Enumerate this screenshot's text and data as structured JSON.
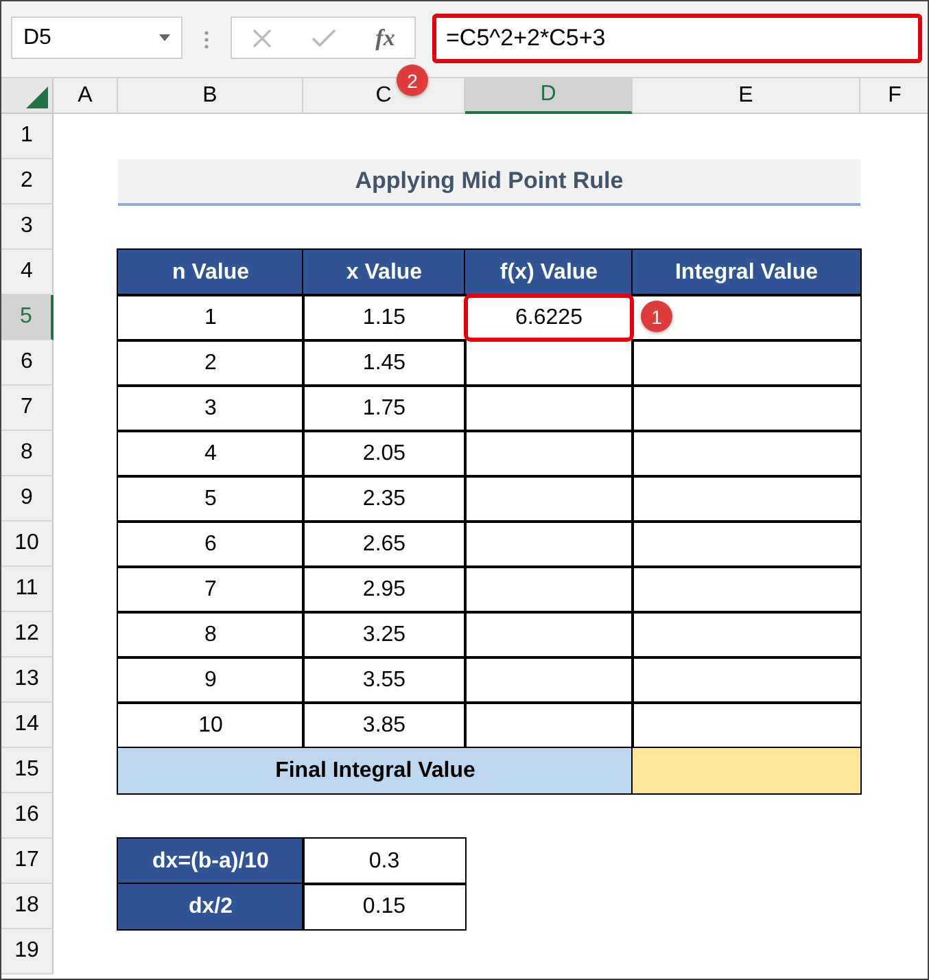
{
  "name_box": {
    "value": "D5"
  },
  "formula_buttons": {
    "function_label": "fx"
  },
  "formula_bar": {
    "value": "=C5^2+2*C5+3",
    "highlighted": true
  },
  "callouts": [
    {
      "number": "1",
      "kind": "cell"
    },
    {
      "number": "2",
      "kind": "formula"
    }
  ],
  "columns": [
    {
      "label": "A",
      "selected": false
    },
    {
      "label": "B",
      "selected": false
    },
    {
      "label": "C",
      "selected": false
    },
    {
      "label": "D",
      "selected": true
    },
    {
      "label": "E",
      "selected": false
    },
    {
      "label": "F",
      "selected": false
    }
  ],
  "rows": [
    {
      "label": "1",
      "selected": false
    },
    {
      "label": "2",
      "selected": false
    },
    {
      "label": "3",
      "selected": false
    },
    {
      "label": "4",
      "selected": false
    },
    {
      "label": "5",
      "selected": true
    },
    {
      "label": "6",
      "selected": false
    },
    {
      "label": "7",
      "selected": false
    },
    {
      "label": "8",
      "selected": false
    },
    {
      "label": "9",
      "selected": false
    },
    {
      "label": "10",
      "selected": false
    },
    {
      "label": "11",
      "selected": false
    },
    {
      "label": "12",
      "selected": false
    },
    {
      "label": "13",
      "selected": false
    },
    {
      "label": "14",
      "selected": false
    },
    {
      "label": "15",
      "selected": false
    },
    {
      "label": "16",
      "selected": false
    },
    {
      "label": "17",
      "selected": false
    },
    {
      "label": "18",
      "selected": false
    },
    {
      "label": "19",
      "selected": false
    }
  ],
  "title": "Applying Mid Point Rule",
  "table": {
    "columns": [
      "n Value",
      "x Value",
      "f(x) Value",
      "Integral Value"
    ],
    "rows": [
      {
        "cells": [
          {
            "text": "1",
            "selected": false
          },
          {
            "text": "1.15",
            "selected": false
          },
          {
            "text": "6.6225",
            "selected": true
          },
          {
            "selected": false
          }
        ]
      },
      {
        "cells": [
          {
            "text": "2",
            "selected": false
          },
          {
            "text": "1.45",
            "selected": false
          },
          {
            "selected": false
          },
          {
            "selected": false
          }
        ]
      },
      {
        "cells": [
          {
            "text": "3",
            "selected": false
          },
          {
            "text": "1.75",
            "selected": false
          },
          {
            "selected": false
          },
          {
            "selected": false
          }
        ]
      },
      {
        "cells": [
          {
            "text": "4",
            "selected": false
          },
          {
            "text": "2.05",
            "selected": false
          },
          {
            "selected": false
          },
          {
            "selected": false
          }
        ]
      },
      {
        "cells": [
          {
            "text": "5",
            "selected": false
          },
          {
            "text": "2.35",
            "selected": false
          },
          {
            "selected": false
          },
          {
            "selected": false
          }
        ]
      },
      {
        "cells": [
          {
            "text": "6",
            "selected": false
          },
          {
            "text": "2.65",
            "selected": false
          },
          {
            "selected": false
          },
          {
            "selected": false
          }
        ]
      },
      {
        "cells": [
          {
            "text": "7",
            "selected": false
          },
          {
            "text": "2.95",
            "selected": false
          },
          {
            "selected": false
          },
          {
            "selected": false
          }
        ]
      },
      {
        "cells": [
          {
            "text": "8",
            "selected": false
          },
          {
            "text": "3.25",
            "selected": false
          },
          {
            "selected": false
          },
          {
            "selected": false
          }
        ]
      },
      {
        "cells": [
          {
            "text": "9",
            "selected": false
          },
          {
            "text": "3.55",
            "selected": false
          },
          {
            "selected": false
          },
          {
            "selected": false
          }
        ]
      },
      {
        "cells": [
          {
            "text": "10",
            "selected": false
          },
          {
            "text": "3.85",
            "selected": false
          },
          {
            "selected": false
          },
          {
            "selected": false
          }
        ]
      }
    ],
    "footer": {
      "label": "Final Integral Value"
    }
  },
  "step_table": [
    {
      "label": "dx=(b-a)/10",
      "value": "0.3"
    },
    {
      "label": "dx/2",
      "value": "0.15"
    }
  ]
}
